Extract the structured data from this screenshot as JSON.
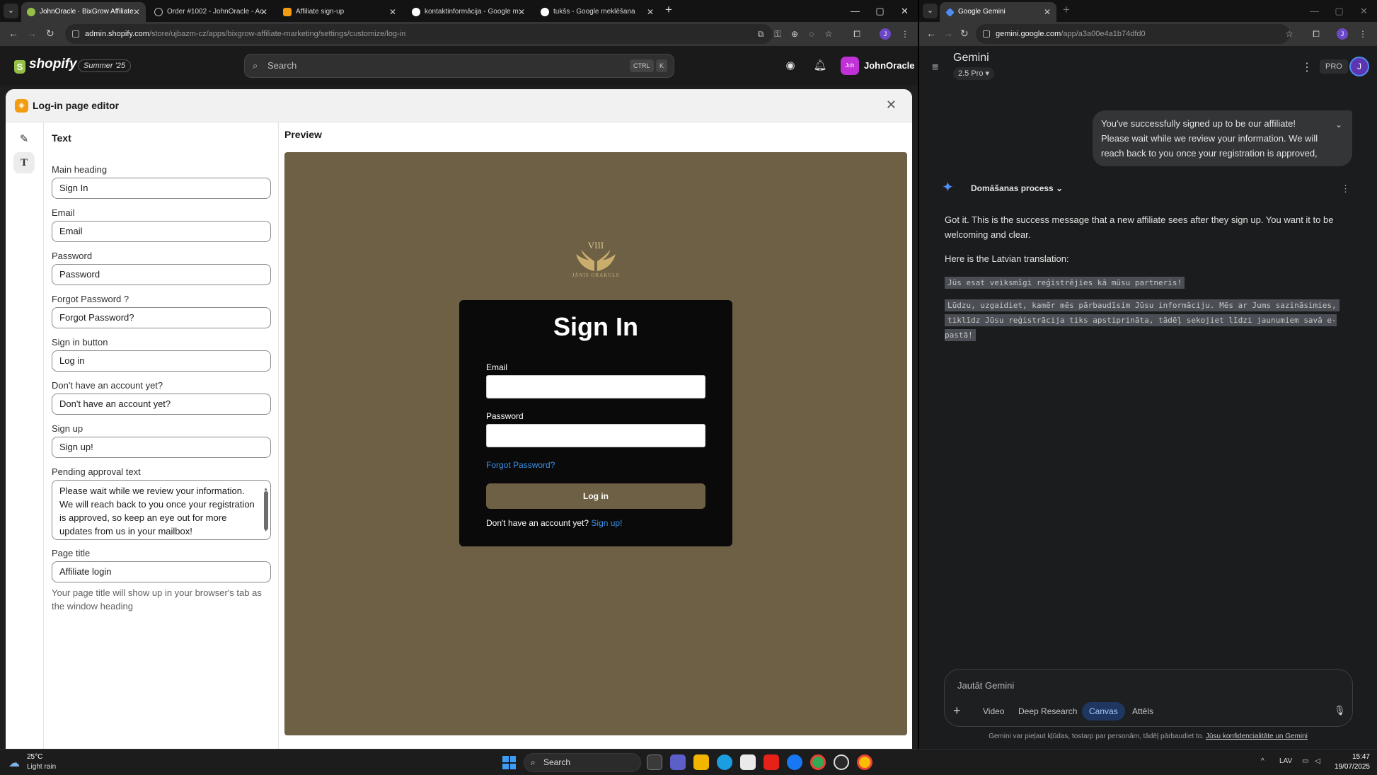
{
  "left_browser": {
    "tabs": [
      {
        "title": "JohnOracle · BixGrow Affiliate ·",
        "active": true
      },
      {
        "title": "Order #1002 - JohnOracle - Ac"
      },
      {
        "title": "Affiliate sign-up"
      },
      {
        "title": "kontaktinformācija - Google m"
      },
      {
        "title": "tukšs - Google meklēšana"
      }
    ],
    "url_host": "admin.shopify.com",
    "url_path": "/store/ujbazm-cz/apps/bixgrow-affiliate-marketing/settings/customize/log-in",
    "profile_initial": "J"
  },
  "shopify": {
    "logo_text": "shopify",
    "edition_badge": "Summer '25",
    "search_placeholder": "Search",
    "shortcut_keys": [
      "CTRL",
      "K"
    ],
    "avatar_text": "Joh",
    "user_name": "JohnOracle"
  },
  "editor": {
    "title": "Log-in page editor",
    "panel_title": "Text",
    "fields": {
      "main_heading": {
        "label": "Main heading",
        "value": "Sign In"
      },
      "email": {
        "label": "Email",
        "value": "Email"
      },
      "password": {
        "label": "Password",
        "value": "Password"
      },
      "forgot_password": {
        "label": "Forgot Password ?",
        "value": "Forgot Password?"
      },
      "sign_in_button": {
        "label": "Sign in button",
        "value": "Log in"
      },
      "no_account": {
        "label": "Don't have an account yet?",
        "value": "Don't have an account yet?"
      },
      "sign_up": {
        "label": "Sign up",
        "value": "Sign up!"
      },
      "pending_approval": {
        "label": "Pending approval text",
        "value": "Please wait while we review your information. We will reach back to you once your registration is approved, so keep an eye out for more updates from us in your mailbox!"
      },
      "page_title": {
        "label": "Page title",
        "value": "Affiliate login",
        "help": "Your page title will show up in your browser's tab as the window heading"
      }
    },
    "preview": {
      "label": "Preview",
      "emblem_roman": "VIII",
      "emblem_brand": "JĀNIS ORAKULS",
      "heading": "Sign In",
      "email_label": "Email",
      "password_label": "Password",
      "forgot_link": "Forgot Password?",
      "login_button": "Log in",
      "footer_text": "Don't have an account yet?",
      "signup_link": "Sign up!",
      "brand_color": "#6e6045"
    }
  },
  "right_browser": {
    "tab_title": "Google Gemini",
    "url_host": "gemini.google.com",
    "url_path": "/app/a3a00e4a1b74dfd0",
    "profile_initial": "J"
  },
  "gemini": {
    "title": "Gemini",
    "model": "2.5 Pro",
    "pro_badge": "PRO",
    "avatar": "J",
    "user_message": "You've successfully signed up to be our affiliate! Please wait while we review your information. We will reach back to you once your registration is approved, s...",
    "thinking_label": "Domāšanas process",
    "response_intro": "Got it. This is the success message that a new affiliate sees after they sign up. You want it to be welcoming and clear.",
    "response_lead": "Here is the Latvian translation:",
    "translation_line1": "Jūs esat veiksmīgi reģistrējies kā mūsu partneris!",
    "translation_line2a": "Lūdzu, uzgaidiet, kamēr mēs pārbaudīsim Jūsu informāciju. Mēs ar Jums sazināsimies,",
    "translation_line2b": "tiklīdz Jūsu reģistrācija tiks apstiprināta, tādēļ sekojiet līdzi jaunumiem savā e-pastā!",
    "prompt_placeholder": "Jautāt Gemini",
    "tools": [
      "Video",
      "Deep Research",
      "Canvas",
      "Attēls"
    ],
    "active_tool": "Canvas",
    "disclaimer_text": "Gemini var pieļaut kļūdas, tostarp par personām, tādēļ pārbaudiet to.",
    "disclaimer_link": "Jūsu konfidencialitāte un Gemini"
  },
  "taskbar": {
    "weather_temp": "25°C",
    "weather_desc": "Light rain",
    "search_label": "Search",
    "tray_lang": "LAV",
    "time": "15:47",
    "date": "19/07/2025"
  }
}
